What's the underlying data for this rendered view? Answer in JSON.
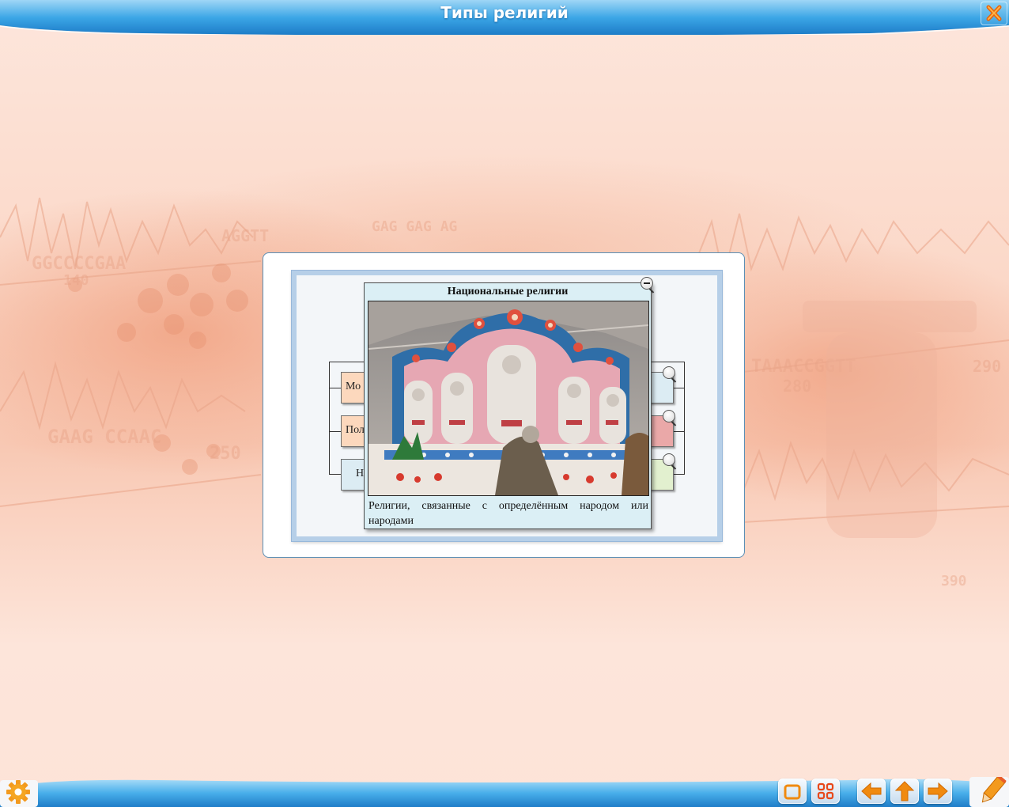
{
  "window": {
    "title": "Типы религий"
  },
  "popup": {
    "title": "Национальные религии",
    "caption": "Религии, связанные с определённым народом или народами",
    "photo_icon": "hindu-shrine-photo"
  },
  "diagram": {
    "left_boxes": [
      {
        "label": "Мо",
        "color": "#fcd8bd"
      },
      {
        "label": "Пол",
        "color": "#fcd8bd"
      },
      {
        "label": "Н",
        "color": "#dcecf3"
      }
    ],
    "right_boxes": [
      {
        "color": "#dcecf3"
      },
      {
        "color": "#eaa8a8"
      },
      {
        "color": "#e2f0cf"
      }
    ]
  },
  "toolbar": {
    "settings_icon": "gear-icon",
    "icons": [
      "window-icon",
      "grid-icon",
      "arrow-left-icon",
      "arrow-up-icon",
      "arrow-right-icon",
      "pencil-icon"
    ]
  },
  "colors": {
    "top_bar": "#2a8fd6",
    "popup_bg": "#dbeff5",
    "accent_orange": "#f08a10"
  }
}
